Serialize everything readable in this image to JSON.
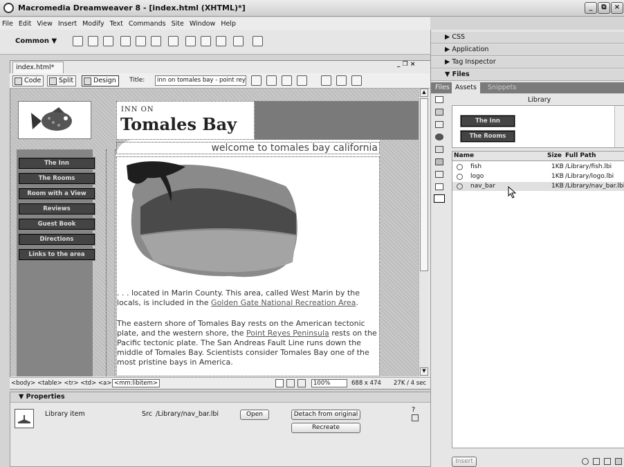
{
  "app": {
    "title": "Macromedia Dreamweaver 8 - [index.html (XHTML)*]",
    "window_buttons": [
      "_",
      "⧉",
      "×"
    ]
  },
  "menu": [
    "File",
    "Edit",
    "View",
    "Insert",
    "Modify",
    "Text",
    "Commands",
    "Site",
    "Window",
    "Help"
  ],
  "insert_bar": {
    "category": "Common ▼"
  },
  "document": {
    "tab": "index.html*",
    "win_controls": "_ ❒ ×",
    "views": {
      "code": "Code",
      "split": "Split",
      "design": "Design"
    },
    "title_label": "Title:",
    "title_value": "inn on tomales bay - point reye"
  },
  "page": {
    "logo_small": "INN ON",
    "logo_big": "Tomales Bay",
    "welcome": "welcome to tomales bay california",
    "nav": [
      "The Inn",
      "The Rooms",
      "Room with a View",
      "Reviews",
      "Guest Book",
      "Directions",
      "Links to the area"
    ],
    "para1_text": ". . . located in Marin County. This area, called West Marin by the locals, is included in the ",
    "para1_link": "Golden Gate National Recreation Area",
    "para1_end": ".",
    "para2_text": "The eastern shore of Tomales Bay rests on the American tectonic plate, and the western shore, the ",
    "para2_link": "Point Reyes Peninsula",
    "para2_end": " rests on the Pacific tectonic plate. The San Andreas Fault Line runs down the middle of Tomales Bay. Scientists consider Tomales Bay one of the most pristine bays in America."
  },
  "status": {
    "tags": "<body> <table> <tr> <td> <a> ",
    "lib_tag": "<mm:libitem>",
    "zoom": "100%",
    "size": "688 x 474",
    "download": "27K / 4 sec"
  },
  "properties": {
    "title": "▼ Properties",
    "item_label": "Library item",
    "src_label": "Src",
    "src_value": "/Library/nav_bar.lbi",
    "open": "Open",
    "detach": "Detach from original",
    "recreate": "Recreate"
  },
  "panels": {
    "css": "▶ CSS",
    "application": "▶ Application",
    "tag_inspector": "▶ Tag Inspector",
    "files": "▼ Files",
    "tabs": [
      "Files",
      "Assets",
      "Snippets"
    ],
    "library_label": "Library",
    "preview_buttons": [
      "The Inn",
      "The Rooms"
    ],
    "columns": {
      "name": "Name",
      "size": "Size",
      "path": "Full Path"
    },
    "items": [
      {
        "name": "fish",
        "size": "1KB",
        "path": "/Library/fish.lbi"
      },
      {
        "name": "logo",
        "size": "1KB",
        "path": "/Library/logo.lbi"
      },
      {
        "name": "nav_bar",
        "size": "1KB",
        "path": "/Library/nav_bar.lbi"
      }
    ],
    "insert": "Insert"
  }
}
